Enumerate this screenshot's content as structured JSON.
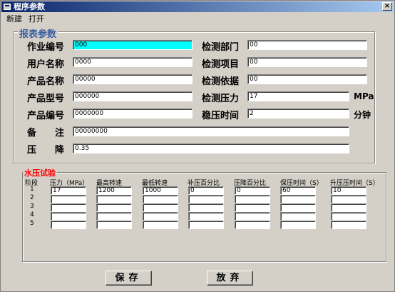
{
  "window": {
    "title": "程序参数",
    "close": "×"
  },
  "menu": [
    "新建",
    "打开"
  ],
  "report": {
    "group_title": "报表参数",
    "job_no_label": "作业编号",
    "job_no": "000",
    "user_name_label": "用户名称",
    "user_name": "0000",
    "product_name_label": "产品名称",
    "product_name": "00000",
    "product_model_label": "产品型号",
    "product_model": "000000",
    "product_no_label": "产品编号",
    "product_no": "0000000",
    "remark_label": "备　　注",
    "remark": "00000000",
    "pressure_drop_label": "压　　降",
    "pressure_drop": "0.35",
    "dept_label": "检测部门",
    "dept": "00",
    "item_label": "检测项目",
    "item": "00",
    "basis_label": "检测依据",
    "basis": "00",
    "pressure_label": "检测压力",
    "pressure": "17",
    "pressure_unit": "MPa",
    "hold_time_label": "稳压时间",
    "hold_time": "2",
    "hold_unit": "分钟"
  },
  "hydro": {
    "group_title": "水压试验",
    "columns": [
      "阶段",
      "压力（MPa）",
      "最高转速",
      "最低转速",
      "补压百分比",
      "压降百分比",
      "保压时间（S）",
      "升压压时间（S）"
    ],
    "rows": [
      {
        "stage": "1",
        "values": [
          "17",
          "1200",
          "1000",
          "0",
          "0",
          "60",
          "10"
        ]
      },
      {
        "stage": "2",
        "values": [
          "",
          "",
          "",
          "",
          "",
          "",
          ""
        ]
      },
      {
        "stage": "3",
        "values": [
          "",
          "",
          "",
          "",
          "",
          "",
          ""
        ]
      },
      {
        "stage": "4",
        "values": [
          "",
          "",
          "",
          "",
          "",
          "",
          ""
        ]
      },
      {
        "stage": "5",
        "values": [
          "",
          "",
          "",
          "",
          "",
          "",
          ""
        ]
      }
    ]
  },
  "buttons": {
    "save": "保存",
    "discard": "放弃"
  }
}
